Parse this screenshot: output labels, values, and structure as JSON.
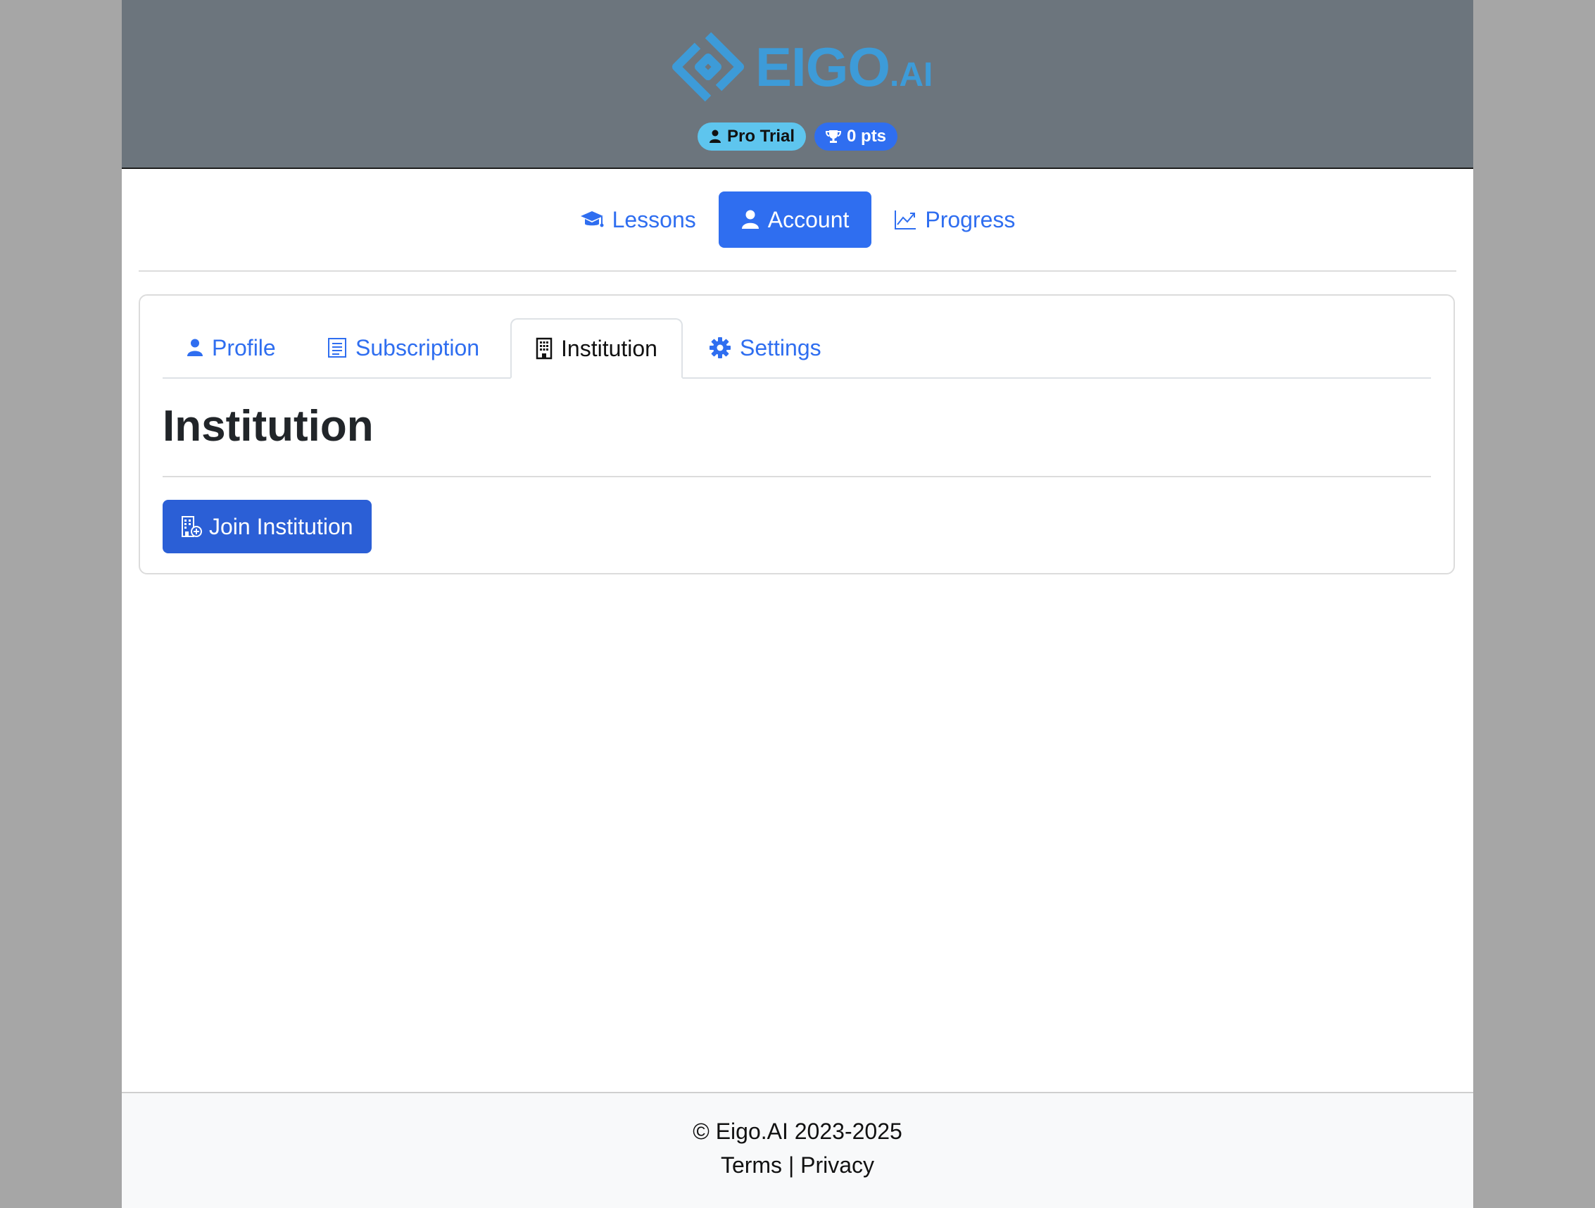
{
  "header": {
    "logo_text_main": "EIGO",
    "logo_text_suffix": ".AI",
    "badges": {
      "trial_label": "Pro Trial",
      "points_label": "0 pts"
    }
  },
  "main_nav": {
    "items": [
      {
        "label": "Lessons",
        "icon": "graduation-cap-icon",
        "active": false
      },
      {
        "label": "Account",
        "icon": "user-icon",
        "active": true
      },
      {
        "label": "Progress",
        "icon": "chart-line-icon",
        "active": false
      }
    ]
  },
  "account_tabs": {
    "items": [
      {
        "label": "Profile",
        "icon": "user-icon",
        "active": false
      },
      {
        "label": "Subscription",
        "icon": "receipt-icon",
        "active": false
      },
      {
        "label": "Institution",
        "icon": "building-icon",
        "active": true
      },
      {
        "label": "Settings",
        "icon": "gear-icon",
        "active": false
      }
    ]
  },
  "institution": {
    "title": "Institution",
    "join_button_label": "Join Institution"
  },
  "footer": {
    "copyright": "© Eigo.AI 2023-2025",
    "terms": "Terms",
    "separator": "|",
    "privacy": "Privacy"
  },
  "colors": {
    "accent": "#2f6ef0",
    "header_bg": "#6c757d",
    "logo": "#3d9bd8",
    "trial_badge": "#5ec5ee"
  }
}
